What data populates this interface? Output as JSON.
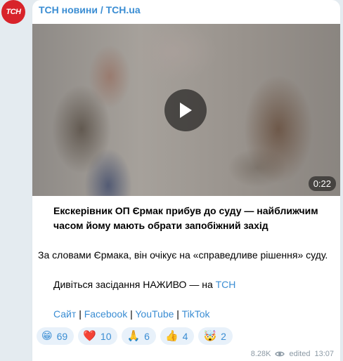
{
  "channel": {
    "avatar_text": "TCH",
    "name": "ТСН новини / TCH.ua",
    "brand_color": "#d8232a",
    "link_color": "#3a8dd3"
  },
  "video": {
    "duration": "0:22",
    "play_icon": "play-icon"
  },
  "post": {
    "headline": "Екскерівник ОП Єрмак прибув до суду — найближчим часом йому мають обрати запобіжний захід",
    "body": "За словами Єрмака, він очікує на «справедливе рішення» суду.",
    "watch_prefix": "Дивіться засідання НАЖИВО — на ",
    "watch_link": "ТСН",
    "links": [
      "Сайт",
      "Facebook",
      "YouTube",
      "TikTok"
    ],
    "separator": "|"
  },
  "reactions": [
    {
      "emoji": "😁",
      "icon": "grin-emoji-icon",
      "count": "69"
    },
    {
      "emoji": "❤️",
      "icon": "heart-emoji-icon",
      "count": "10"
    },
    {
      "emoji": "🙏",
      "icon": "pray-emoji-icon",
      "count": "6"
    },
    {
      "emoji": "👍",
      "icon": "thumbs-up-emoji-icon",
      "count": "4"
    },
    {
      "emoji": "🤯",
      "icon": "mind-blown-emoji-icon",
      "count": "2"
    }
  ],
  "meta": {
    "views": "8.28K",
    "views_icon": "eye-icon",
    "edited": "edited",
    "time": "13:07"
  }
}
